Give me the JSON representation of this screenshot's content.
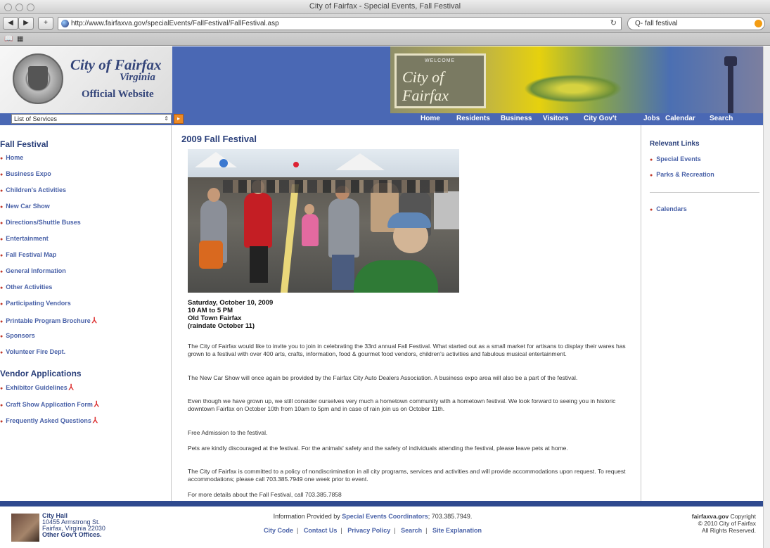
{
  "browser": {
    "window_title": "City of Fairfax - Special Events, Fall Festival",
    "url": "http://www.fairfaxva.gov/specialEvents/FallFestival/FallFestival.asp",
    "search_value": "fall festival"
  },
  "header": {
    "logo_city": "City of Fairfax",
    "logo_state": "Virginia",
    "logo_official": "Official Website",
    "banner_sign_small": "WELCOME",
    "banner_sign_text": "City of Fairfax"
  },
  "navstrip": {
    "services_select": "List of Services",
    "topnav": [
      "Home",
      "Residents",
      "Business",
      "Visitors",
      "City Gov't",
      "Jobs",
      "Calendar",
      "Search"
    ]
  },
  "leftnav": {
    "fall_head": "Fall Festival",
    "fall_links": [
      "Home",
      "Business Expo",
      "Children's Activities",
      "New Car Show",
      "Directions/Shuttle Buses",
      "Entertainment",
      "Fall Festival Map",
      "General Information",
      "Other Activities",
      "Participating Vendors",
      "Printable Program Brochure",
      "Sponsors",
      "Volunteer Fire Dept."
    ],
    "vendor_head": "Vendor Applications",
    "vendor_links": [
      "Exhibitor Guidelines",
      "Craft Show Application Form",
      "Frequently Asked Questions"
    ]
  },
  "main": {
    "title": "2009 Fall Festival",
    "event_info": [
      "Saturday, October 10, 2009",
      "10 AM to 5 PM",
      "Old Town Fairfax",
      "(raindate October 11)"
    ],
    "paragraphs": [
      "The City of Fairfax would like to invite you to join in celebrating the 33rd annual Fall Festival. What started out as a small market for artisans to display their wares has grown to a festival with over 400 arts, crafts, information, food & gourmet food vendors, children's activities and fabulous musical entertainment.",
      "The New Car Show will once again be provided by the Fairfax City Auto Dealers Association. A business expo area will also be a part of the festival.",
      "Even though we have grown up, we still consider ourselves very much a hometown community with a hometown festival. We look forward to seeing you in historic downtown Fairfax on October 10th from 10am to 5pm and in case of rain join us on October 11th.",
      "Free Admission to the festival.",
      "Pets are kindly discouraged at the festival. For the animals' safety and the safety of individuals attending the festival, please leave pets at home.",
      "The City of Fairfax is committed to a policy of nondiscrimination in all city programs, services and activities and will provide accommodations upon request. To request accommodations; please call 703.385.7949 one week prior to event.",
      "For more details about the Fall Festival, call 703.385.7858"
    ]
  },
  "rightnav": {
    "head": "Relevant Links",
    "links": [
      "Special Events",
      "Parks & Recreation"
    ],
    "links2": [
      "Calendars"
    ]
  },
  "footer": {
    "hall_name": "City Hall",
    "addr1": "10455 Armstrong St.",
    "addr2": "Fairfax, Virginia 22030",
    "addr3": "Other Gov't Offices.",
    "info_prefix": "Information Provided by",
    "info_link": "Special Events Coordinators",
    "info_phone": "; 703.385.7949.",
    "links": [
      "City Code",
      "Contact Us",
      "Privacy Policy",
      "Search",
      "Site Explanation"
    ],
    "right1_bold": "fairfaxva.gov",
    "right1": " Copyright",
    "right2": "© 2010 City of Fairfax",
    "right3": "All Rights Reserved."
  }
}
